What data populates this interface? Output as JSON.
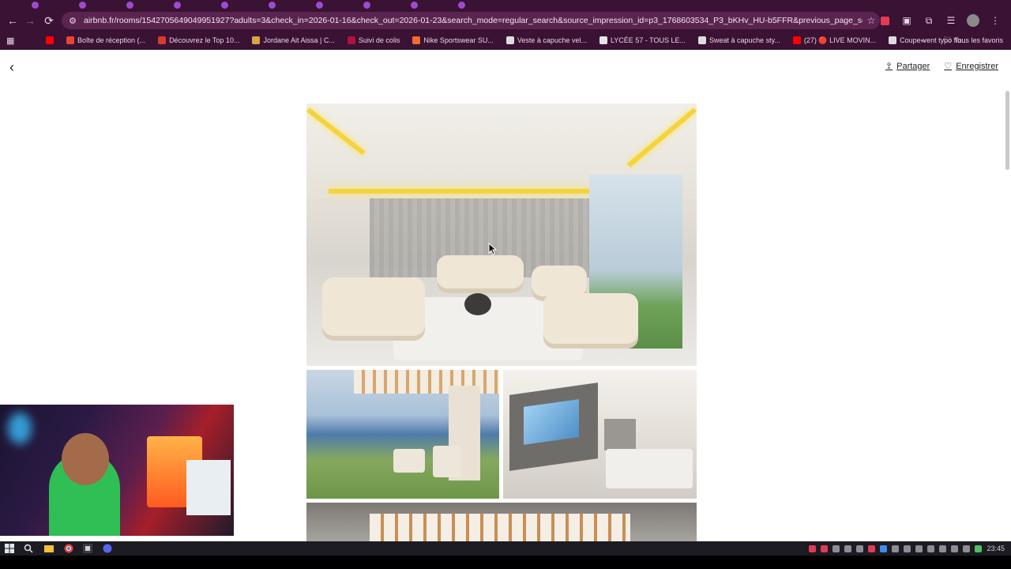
{
  "browser": {
    "url": "airbnb.fr/rooms/1542705649049951927?adults=3&check_in=2026-01-16&check_out=2026-01-23&search_mode=regular_search&source_impression_id=p3_1768603534_P3_bKHv_HU-b5FFR&previous_page_section_name=1000&federat..."
  },
  "bookmarks": {
    "items": [
      {
        "label": "Boîte de réception (...",
        "color": "#ea4335"
      },
      {
        "label": "Découvrez le Top 10...",
        "color": "#d83a2b"
      },
      {
        "label": "Jordane Ait Aissa | C...",
        "color": "#d9a441"
      },
      {
        "label": "Suivi de colis",
        "color": "#b0123b"
      },
      {
        "label": "Nike Sportswear SU...",
        "color": "#f26a2e"
      },
      {
        "label": "Veste à capuche vel...",
        "color": "#dddddd"
      },
      {
        "label": "LYCÉE 57 - TOUS LE...",
        "color": "#e5e5e5"
      },
      {
        "label": "Sweat à capuche sty...",
        "color": "#dddddd"
      },
      {
        "label": "(27) 🔴 LIVE MOVIN...",
        "color": "#ff0000"
      },
      {
        "label": "Coupe-vent typo flu...",
        "color": "#dddddd"
      }
    ],
    "all_label": "Tous les favoris"
  },
  "page": {
    "share_label": "Partager",
    "save_label": "Enregistrer"
  },
  "taskbar": {
    "clock": "23:45"
  },
  "colors": {
    "chrome": "#3a1233",
    "led": "#f5d33c"
  }
}
